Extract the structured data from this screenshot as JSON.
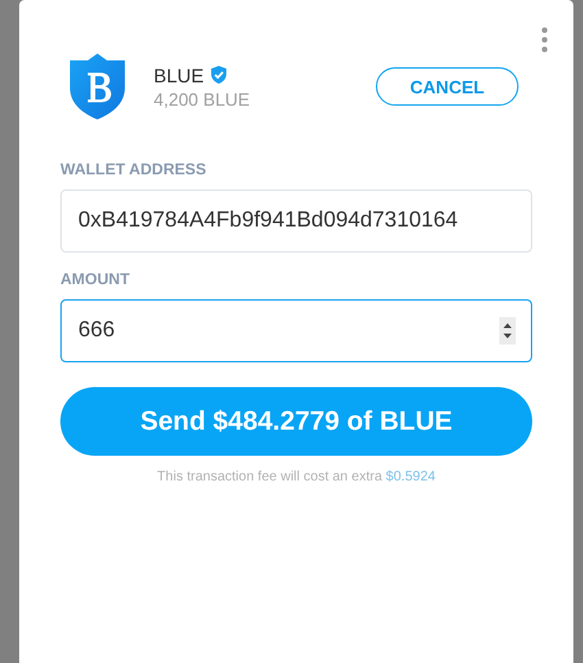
{
  "token": {
    "name": "BLUE",
    "verified": true,
    "balance": "4,200 BLUE"
  },
  "cancel_button": "CANCEL",
  "fields": [
    {
      "label": "WALLET ADDRESS",
      "value": "0xB419784A4Fb9f941Bd094d7310164",
      "focused": false,
      "kind": "text"
    },
    {
      "label": "AMOUNT",
      "value": "666",
      "focused": true,
      "kind": "number"
    }
  ],
  "send_button": "Send $484.2779 of BLUE",
  "fee": {
    "text": "This transaction fee will cost an extra",
    "amount": "$0.5924"
  }
}
